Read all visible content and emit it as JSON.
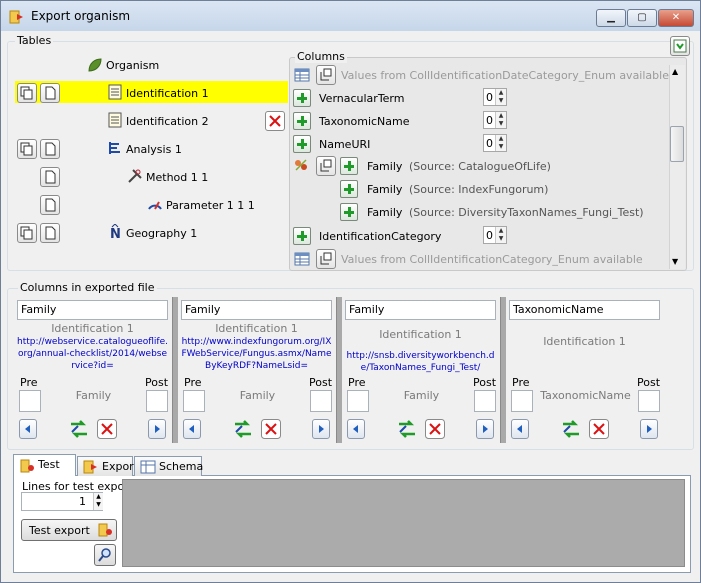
{
  "window": {
    "title": "Export organism"
  },
  "tables": {
    "label": "Tables",
    "items": [
      {
        "label": "Organism"
      },
      {
        "label": "Identification 1"
      },
      {
        "label": "Identification 2"
      },
      {
        "label": "Analysis 1"
      },
      {
        "label": "Method 1 1"
      },
      {
        "label": "Parameter 1 1 1"
      },
      {
        "label": "Geography 1"
      }
    ]
  },
  "columns": {
    "label": "Columns",
    "rows": [
      {
        "label": "Values from CollIdentificationDateCategory_Enum available"
      },
      {
        "label": "VernacularTerm",
        "value": "0"
      },
      {
        "label": "TaxonomicName",
        "value": "0"
      },
      {
        "label": "NameURI",
        "value": "0"
      },
      {
        "label": "Family",
        "source": "(Source: CatalogueOfLife)"
      },
      {
        "label": "Family",
        "source": "(Source: IndexFungorum)"
      },
      {
        "label": "Family",
        "source": "(Source: DiversityTaxonNames_Fungi_Test)"
      },
      {
        "label": "IdentificationCategory",
        "value": "0"
      },
      {
        "label": "Values from CollIdentificationCategory_Enum available"
      }
    ]
  },
  "exported": {
    "label": "Columns in exported file",
    "columns": [
      {
        "name": "Family",
        "table": "Identification 1",
        "url": "http://webservice.catalogueoflife.org/annual-checklist/2014/webservice?id=",
        "pre": "Pre",
        "post": "Post",
        "column": "Family"
      },
      {
        "name": "Family",
        "table": "Identification 1",
        "url": "http://www.indexfungorum.org/IXFWebService/Fungus.asmx/NameByKeyRDF?NameLsid=",
        "pre": "Pre",
        "post": "Post",
        "column": "Family"
      },
      {
        "name": "Family",
        "table": "Identification 1",
        "url": "http://snsb.diversityworkbench.de/TaxonNames_Fungi_Test/",
        "pre": "Pre",
        "post": "Post",
        "column": "Family"
      },
      {
        "name": "TaxonomicName",
        "table": "Identification 1",
        "url": "",
        "pre": "Pre",
        "post": "Post",
        "column": "TaxonomicName"
      }
    ]
  },
  "tabs": [
    {
      "label": "Test"
    },
    {
      "label": "Export"
    },
    {
      "label": "Schema"
    }
  ],
  "test": {
    "lines_label": "Lines for test export:",
    "lines_value": "1",
    "test_export_label": "Test export"
  }
}
